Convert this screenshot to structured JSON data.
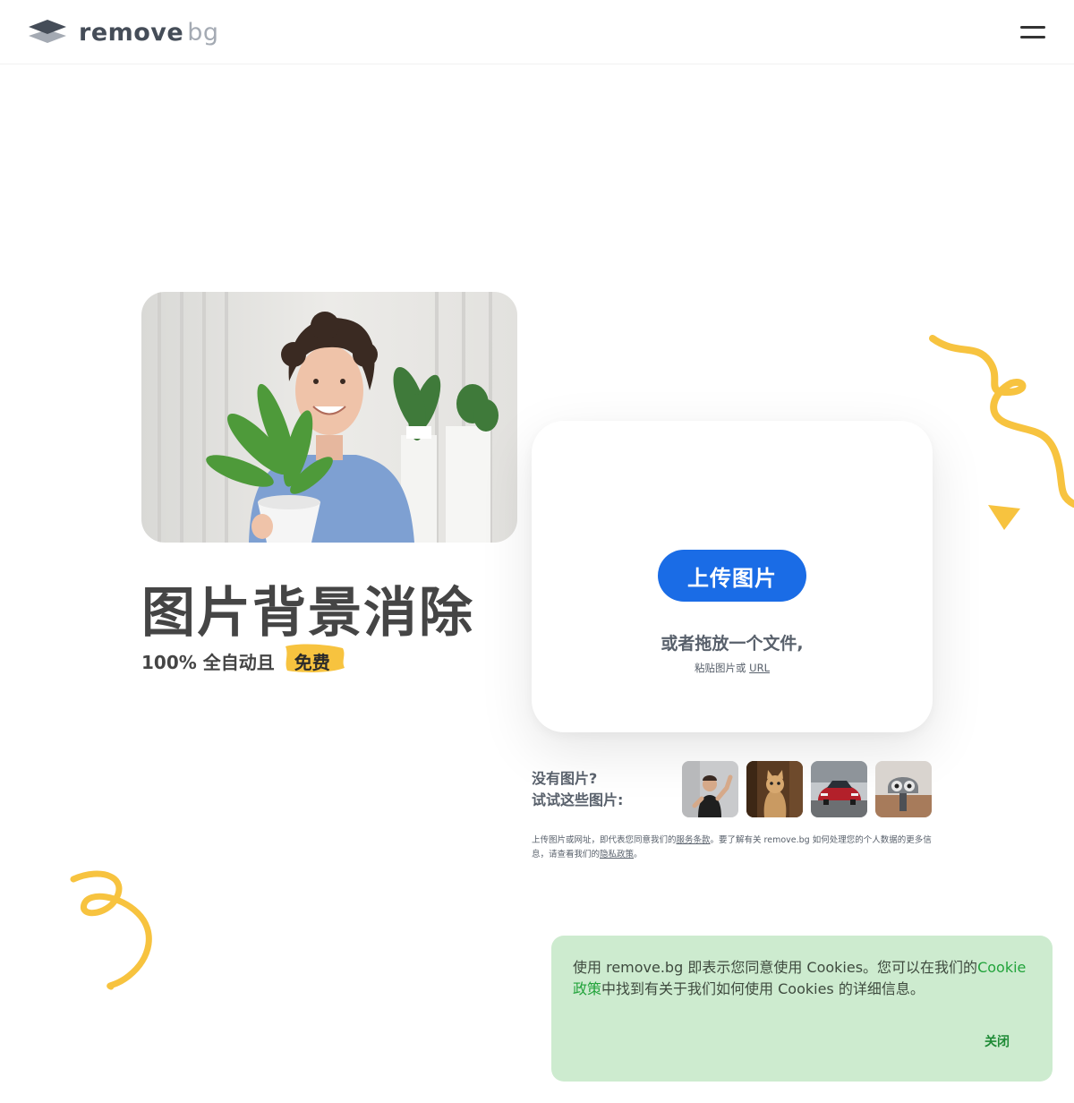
{
  "header": {
    "logo_text_main": "remove",
    "logo_text_bg": "bg",
    "menu_icon": "hamburger-icon"
  },
  "hero": {
    "title": "图片背景消除",
    "subtitle": "100% 全自动且",
    "free_badge": "免费",
    "accent_yellow": "#f7c33f"
  },
  "upload": {
    "button_label": "上传图片",
    "drop_text": "或者拖放一个文件,",
    "paste_prefix": "粘贴图片或 ",
    "paste_link": "URL",
    "button_color": "#1a6ce6"
  },
  "samples": {
    "label_line1": "没有图片?",
    "label_line2": "试试这些图片:",
    "items": [
      "woman",
      "cat",
      "car",
      "binoculars"
    ]
  },
  "terms": {
    "part1": "上传图片或网址，即代表您同意我们的",
    "terms_link": "服务条款",
    "part2": "。要了解有关 remove.bg 如何处理您的个人数据的更多信息，请查看我们的",
    "privacy_link": "隐私政策",
    "part3": "。"
  },
  "cookie": {
    "text_part1": "使用 remove.bg 即表示您同意使用 Cookies。您可以在我们的",
    "policy_link": "Cookie政策",
    "text_part2": "中找到有关于我们如何使用 Cookies 的详细信息。",
    "close_label": "关闭",
    "background": "#cdebcf"
  }
}
